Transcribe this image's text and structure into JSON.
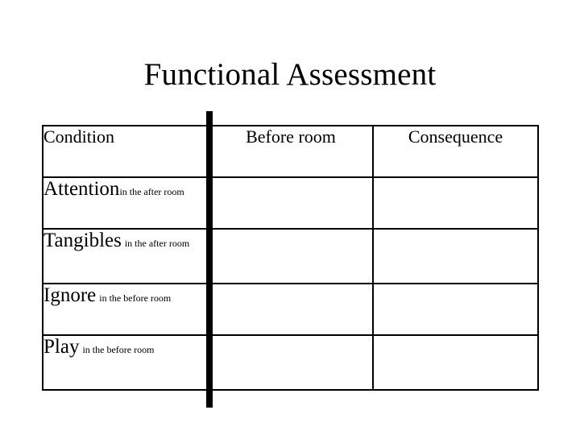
{
  "slide": {
    "title": "Functional Assessment",
    "background_color": "#ffffff",
    "text_color": "#000000"
  },
  "table": {
    "columns": [
      {
        "key": "condition",
        "header": "Condition",
        "align": "left"
      },
      {
        "key": "before_room",
        "header": "Before room",
        "align": "center"
      },
      {
        "key": "consequence",
        "header": "Consequence",
        "align": "center"
      }
    ],
    "rows": [
      {
        "condition_main": "Attention",
        "condition_sub": "in the after room",
        "before_room": "",
        "consequence": ""
      },
      {
        "condition_main": "Tangibles",
        "condition_sub": "in the after room",
        "before_room": "",
        "consequence": ""
      },
      {
        "condition_main": "Ignore",
        "condition_sub": "in the before room",
        "before_room": "",
        "consequence": ""
      },
      {
        "condition_main": "Play",
        "condition_sub": "in the before room",
        "before_room": "",
        "consequence": ""
      }
    ]
  }
}
